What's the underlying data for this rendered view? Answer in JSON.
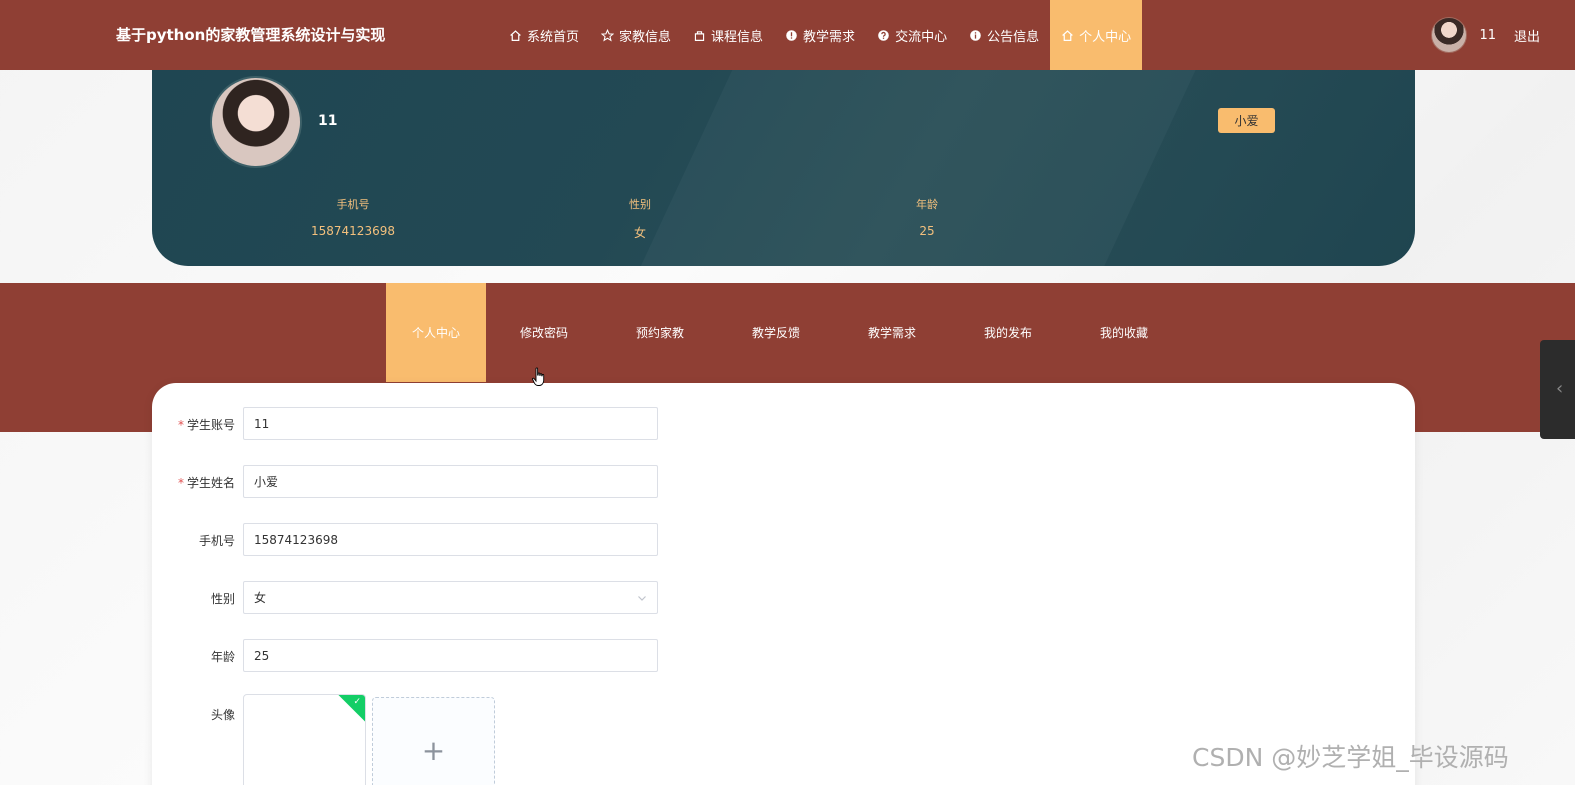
{
  "header": {
    "site_title": "基于python的家教管理系统设计与实现",
    "nav": [
      {
        "label": "系统首页",
        "icon": "home-icon"
      },
      {
        "label": "家教信息",
        "icon": "star-icon"
      },
      {
        "label": "课程信息",
        "icon": "bag-icon"
      },
      {
        "label": "教学需求",
        "icon": "info-icon"
      },
      {
        "label": "交流中心",
        "icon": "question-icon"
      },
      {
        "label": "公告信息",
        "icon": "info-icon"
      },
      {
        "label": "个人中心",
        "icon": "home-icon",
        "active": true
      }
    ],
    "username": "11",
    "logout_label": "退出"
  },
  "profile": {
    "name": "11",
    "role_badge": "小爱",
    "stats": [
      {
        "label": "手机号",
        "value": "15874123698"
      },
      {
        "label": "性别",
        "value": "女"
      },
      {
        "label": "年龄",
        "value": "25"
      }
    ]
  },
  "tabs": [
    "个人中心",
    "修改密码",
    "预约家教",
    "教学反馈",
    "教学需求",
    "我的发布",
    "我的收藏"
  ],
  "form": {
    "account": {
      "label": "学生账号",
      "value": "11",
      "required": true
    },
    "name": {
      "label": "学生姓名",
      "value": "小爱",
      "required": true
    },
    "phone": {
      "label": "手机号",
      "value": "15874123698"
    },
    "gender": {
      "label": "性别",
      "value": "女"
    },
    "age": {
      "label": "年龄",
      "value": "25"
    },
    "avatar": {
      "label": "头像",
      "add_symbol": "+"
    }
  },
  "watermark": "CSDN @妙芝学姐_毕设源码",
  "colors": {
    "primary": "#8f3f34",
    "accent": "#f9bc6e",
    "card": "#234954",
    "stat_text": "#f3c07d"
  }
}
